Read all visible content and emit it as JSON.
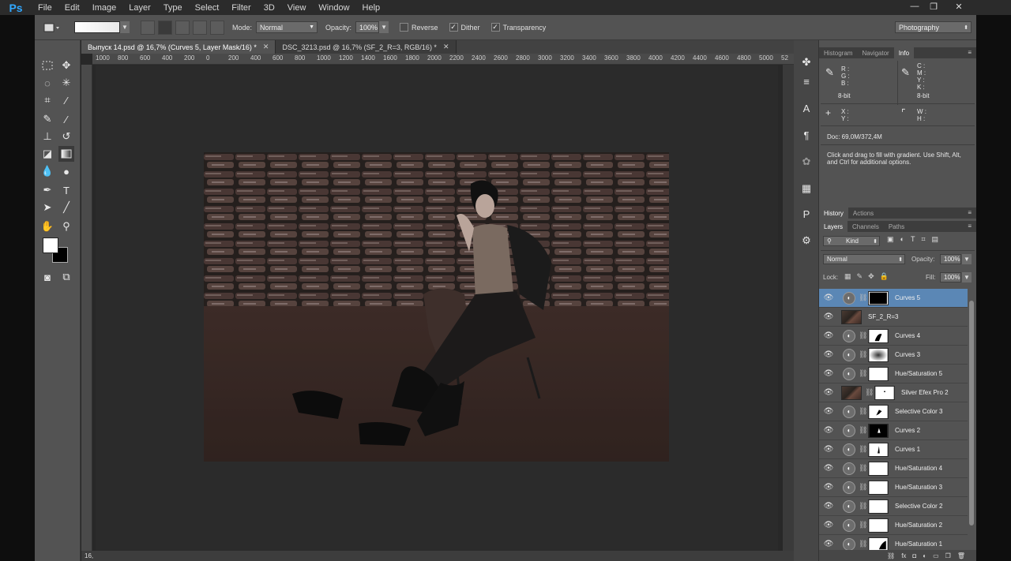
{
  "app": {
    "logo": "Ps"
  },
  "menu": [
    "File",
    "Edit",
    "Image",
    "Layer",
    "Type",
    "Select",
    "Filter",
    "3D",
    "View",
    "Window",
    "Help"
  ],
  "window_controls": {
    "minimize": "—",
    "restore": "❐",
    "close": "✕"
  },
  "options": {
    "mode_label": "Mode:",
    "mode_value": "Normal",
    "opacity_label": "Opacity:",
    "opacity_value": "100%",
    "reverse_label": "Reverse",
    "dither_label": "Dither",
    "transparency_label": "Transparency",
    "reverse_checked": false,
    "dither_checked": true,
    "transparency_checked": true,
    "workspace": "Photography"
  },
  "tabs": [
    {
      "label": "Выпуск 14.psd @ 16,7% (Curves 5, Layer Mask/16) *",
      "active": true
    },
    {
      "label": "DSC_3213.psd @ 16,7% (SF_2_R=3, RGB/16) *",
      "active": false
    }
  ],
  "ruler": [
    "1000",
    "800",
    "600",
    "400",
    "200",
    "0",
    "200",
    "400",
    "600",
    "800",
    "1000",
    "1200",
    "1400",
    "1600",
    "1800",
    "2000",
    "2200",
    "2400",
    "2600",
    "2800",
    "3000",
    "3200",
    "3400",
    "3600",
    "3800",
    "4000",
    "4200",
    "4400",
    "4600",
    "4800",
    "5000",
    "52"
  ],
  "status": {
    "zoom": "16,"
  },
  "info_panel": {
    "tabs": [
      "Histogram",
      "Navigator",
      "Info"
    ],
    "active_tab": "Info",
    "rgb": [
      "R :",
      "G :",
      "B :"
    ],
    "cmyk": [
      "C :",
      "M :",
      "Y :",
      "K :"
    ],
    "bitdepth_left": "8-bit",
    "bitdepth_right": "8-bit",
    "xy": [
      "X :",
      "Y :"
    ],
    "wh": [
      "W :",
      "H :"
    ],
    "doc": "Doc: 69,0M/372,4M",
    "hint": "Click and drag to fill with gradient.  Use Shift, Alt, and Ctrl for additional options."
  },
  "history_tabs": [
    "History",
    "Actions"
  ],
  "layers_tabs": [
    "Layers",
    "Channels",
    "Paths"
  ],
  "layers": {
    "filter": "Kind",
    "blend_mode": "Normal",
    "opacity_label": "Opacity:",
    "opacity_value": "100%",
    "lock_label": "Lock:",
    "fill_label": "Fill:",
    "fill_value": "100%",
    "items": [
      {
        "name": "Curves 5",
        "type": "adj",
        "selected": true
      },
      {
        "name": "SF_2_R=3",
        "type": "pixel",
        "selected": false
      },
      {
        "name": "Curves 4",
        "type": "adj",
        "selected": false
      },
      {
        "name": "Curves 3",
        "type": "adj",
        "selected": false
      },
      {
        "name": "Hue/Saturation 5",
        "type": "adj",
        "selected": false
      },
      {
        "name": "Silver Efex Pro 2",
        "type": "pixel",
        "selected": false
      },
      {
        "name": "Selective Color 3",
        "type": "adj",
        "selected": false
      },
      {
        "name": "Curves 2",
        "type": "adj",
        "selected": false
      },
      {
        "name": "Curves 1",
        "type": "adj",
        "selected": false
      },
      {
        "name": "Hue/Saturation 4",
        "type": "adj",
        "selected": false
      },
      {
        "name": "Hue/Saturation 3",
        "type": "adj",
        "selected": false
      },
      {
        "name": "Selective Color 2",
        "type": "adj",
        "selected": false
      },
      {
        "name": "Hue/Saturation 2",
        "type": "adj",
        "selected": false
      },
      {
        "name": "Hue/Saturation 1",
        "type": "adj",
        "selected": false
      }
    ]
  },
  "layers_footer": [
    "⛓",
    "fx",
    "◘",
    "◐",
    "▭",
    "❐",
    "🗑"
  ],
  "colors": {
    "accent": "#5b87b5",
    "ps_blue": "#31a8ff",
    "panel_bg": "#535353"
  }
}
